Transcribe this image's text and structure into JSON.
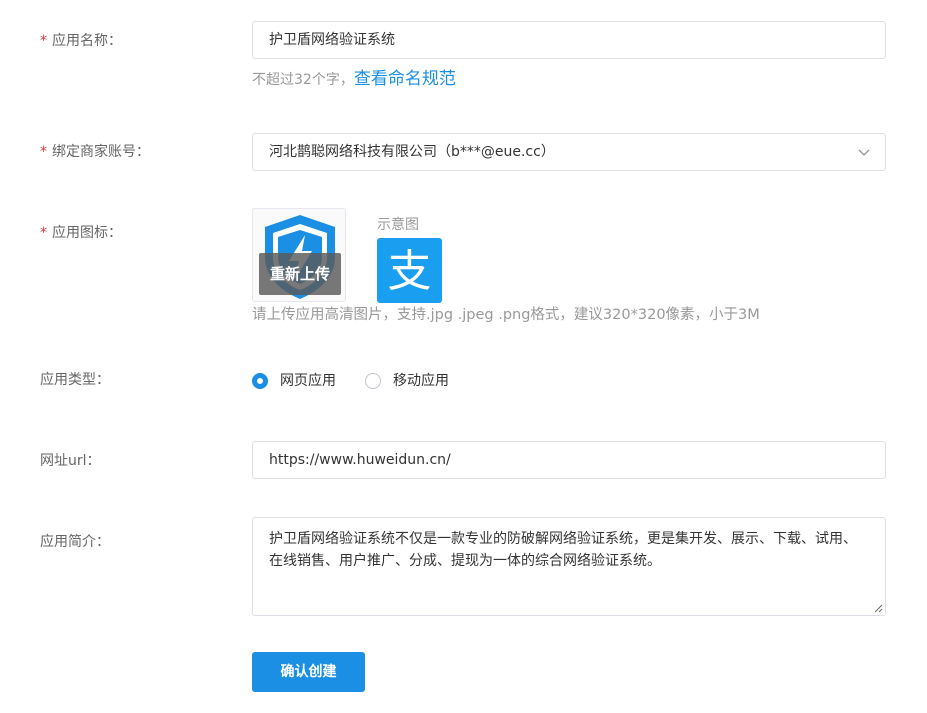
{
  "form": {
    "app_name": {
      "label": "应用名称：",
      "value": "护卫盾网络验证系统",
      "hint": "不超过32个字，",
      "hint_link": "查看命名规范"
    },
    "merchant": {
      "label": "绑定商家账号：",
      "value": "河北鹊聪网络科技有限公司（b***@eue.cc）"
    },
    "icon": {
      "label": "应用图标：",
      "reupload_label": "重新上传",
      "sample_label": "示意图",
      "sample_glyph": "支",
      "hint": "请上传应用高清图片，支持.jpg .jpeg .png格式，建议320*320像素，小于3M"
    },
    "app_type": {
      "label": "应用类型：",
      "options": [
        "网页应用",
        "移动应用"
      ],
      "selected": "网页应用"
    },
    "url": {
      "label": "网址url：",
      "value": "https://www.huweidun.cn/"
    },
    "intro": {
      "label": "应用简介：",
      "value": "护卫盾网络验证系统不仅是一款专业的防破解网络验证系统，更是集开发、展示、下载、试用、在线销售、用户推广、分成、提现为一体的综合网络验证系统。"
    },
    "required_mark": "*",
    "submit_label": "确认创建"
  },
  "colors": {
    "accent": "#1a8fe3",
    "required": "#e4393c",
    "label": "#666666",
    "hint": "#999999",
    "alipay_blue": "#1a9ef0"
  },
  "icons": [
    "chevron-down-icon",
    "shield-lightning-icon",
    "alipay-icon",
    "resize-handle-icon"
  ]
}
